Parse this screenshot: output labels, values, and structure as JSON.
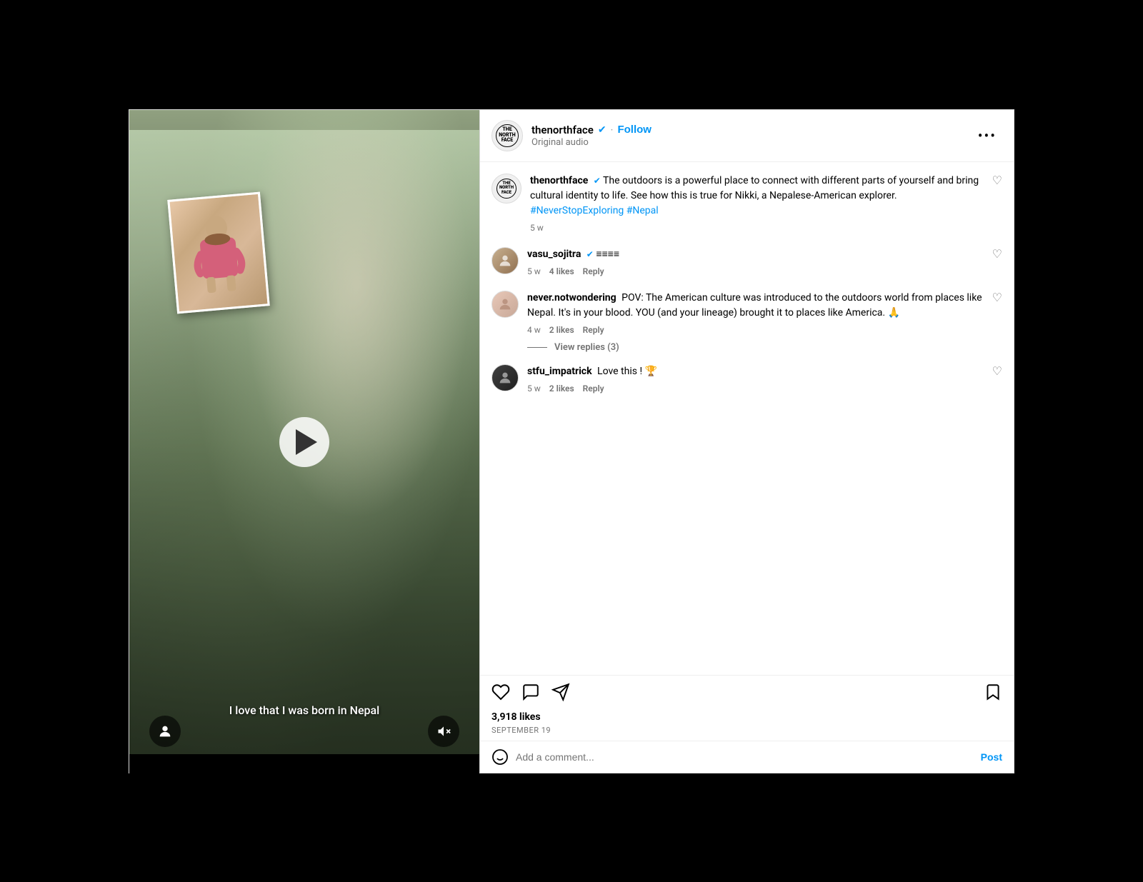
{
  "header": {
    "username": "thenorthface",
    "verified": true,
    "follow_label": "Follow",
    "subtitle": "Original audio",
    "more_icon": "•••"
  },
  "post": {
    "main_comment": {
      "username": "thenorthface",
      "verified": true,
      "text": "The outdoors is a powerful place to connect with different parts of yourself and bring cultural identity to life. See how this is true for Nikki, a Nepalese-American explorer.",
      "hashtags": "#NeverStopExploring #Nepal",
      "time": "5 w"
    },
    "comments": [
      {
        "id": "vasu",
        "username": "vasu_sojitra",
        "verified": true,
        "text": "≡≡≡≡",
        "time": "5 w",
        "likes": "4 likes",
        "reply_label": "Reply"
      },
      {
        "id": "never",
        "username": "never.notwondering",
        "verified": false,
        "text": "POV: The American culture was introduced to the outdoors world from places like Nepal. It's in your blood. YOU (and your lineage) brought it to places like America. 🙏",
        "time": "4 w",
        "likes": "2 likes",
        "reply_label": "Reply",
        "view_replies": "View replies (3)"
      },
      {
        "id": "stfu",
        "username": "stfu_impatrick",
        "verified": false,
        "text": "Love this ! 🏆",
        "time": "5 w",
        "likes": "2 likes",
        "reply_label": "Reply"
      }
    ],
    "likes_count": "3,918 likes",
    "date": "September 19"
  },
  "video": {
    "subtitle": "I love that I was born in Nepal"
  },
  "add_comment": {
    "placeholder": "Add a comment...",
    "post_label": "Post"
  },
  "icons": {
    "heart": "♡",
    "comment": "💬",
    "share": "➤",
    "bookmark": "🔖",
    "emoji": "😊"
  }
}
